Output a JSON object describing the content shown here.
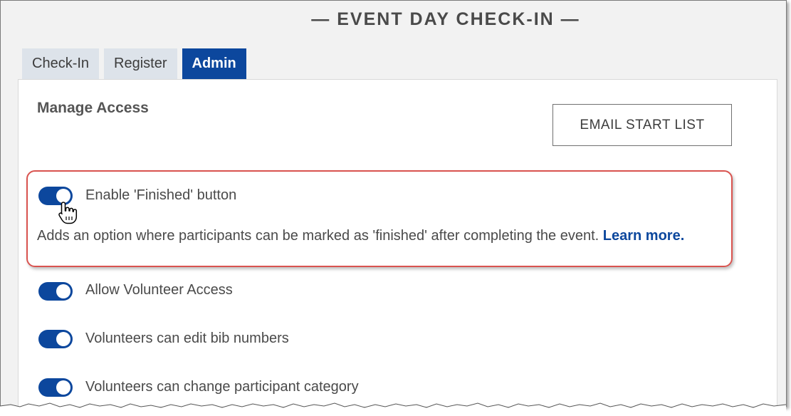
{
  "header": {
    "title": "— EVENT DAY CHECK-IN —"
  },
  "tabs": [
    {
      "label": "Check-In",
      "active": false
    },
    {
      "label": "Register",
      "active": false
    },
    {
      "label": "Admin",
      "active": true
    }
  ],
  "panel": {
    "section_title": "Manage Access",
    "email_button_label": "EMAIL START LIST"
  },
  "settings": [
    {
      "label": "Enable 'Finished' button",
      "enabled": true,
      "description": "Adds an option where participants can be marked as 'finished' after completing the event.",
      "link_label": "Learn more."
    },
    {
      "label": "Allow Volunteer Access",
      "enabled": true
    },
    {
      "label": "Volunteers can edit bib numbers",
      "enabled": true
    },
    {
      "label": "Volunteers can change participant category",
      "enabled": true
    }
  ],
  "colors": {
    "accent": "#0c479d",
    "highlight_border": "#d9534f",
    "tab_inactive": "#dde3ea"
  },
  "icons": {
    "cursor": "hand-pointer-icon"
  }
}
